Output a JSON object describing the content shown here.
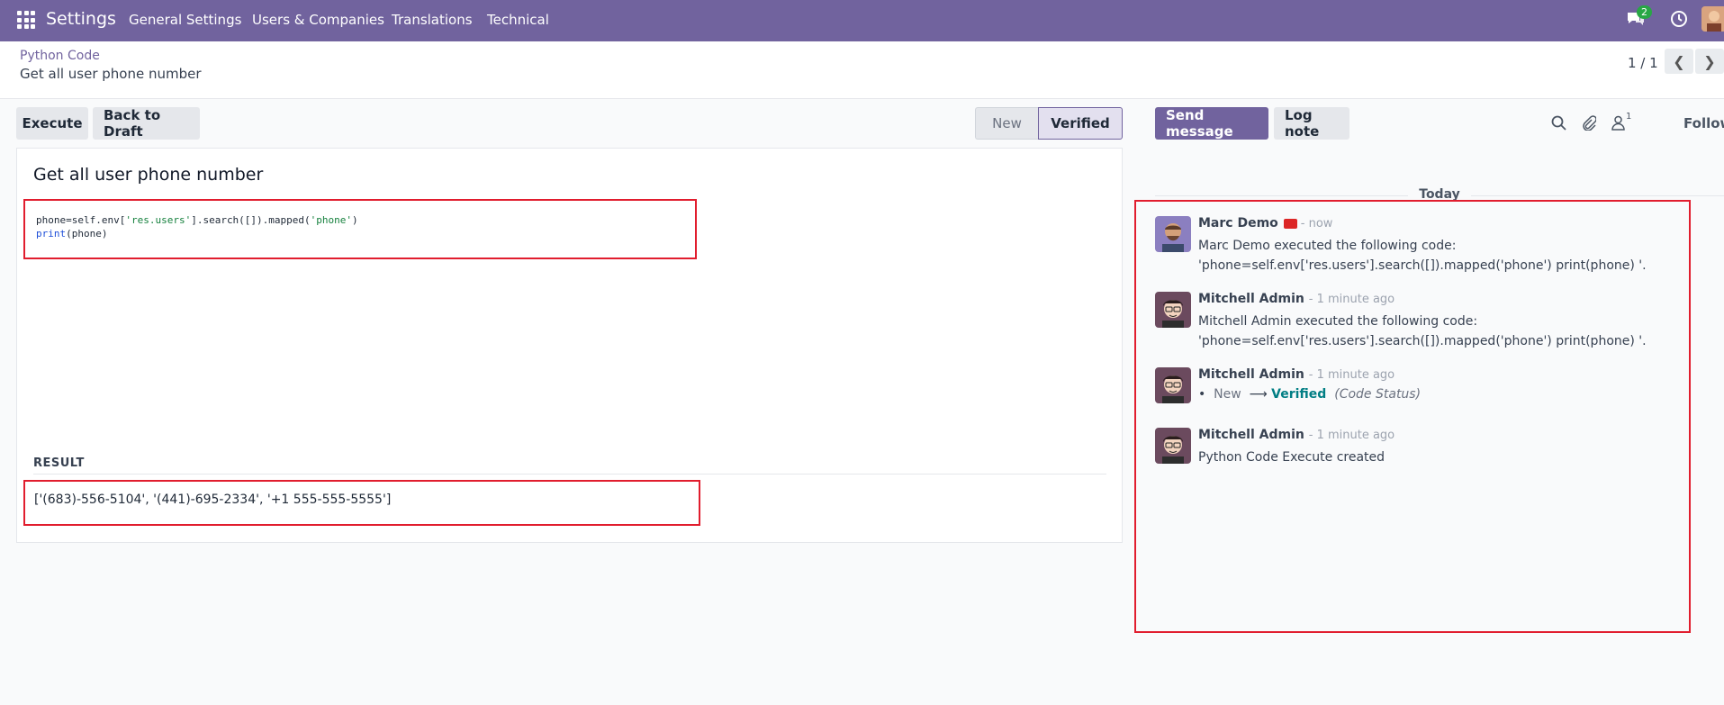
{
  "navbar": {
    "brand": "Settings",
    "menu": [
      "General Settings",
      "Users & Companies",
      "Translations",
      "Technical"
    ],
    "messages_count": "2",
    "apps_icon": "apps-grid-icon",
    "chat_icon": "chat-bubbles-icon",
    "activity_icon": "clock-icon"
  },
  "breadcrumb": {
    "parent": "Python Code",
    "current": "Get all user phone number"
  },
  "pager": {
    "value": "1 / 1"
  },
  "form_buttons": {
    "execute": "Execute",
    "back_to_draft": "Back to Draft"
  },
  "statusbar": {
    "new": "New",
    "verified": "Verified"
  },
  "sheet": {
    "title": "Get all user phone number",
    "code_line1_a": "phone=self.env[",
    "code_line1_str1": "'res.users'",
    "code_line1_b": "].search([]).mapped(",
    "code_line1_str2": "'phone'",
    "code_line1_c": ")",
    "code_line2_kw": "print",
    "code_line2_b": "(phone)",
    "result_label": "RESULT",
    "result_value": "['(683)-556-5104', '(441)-695-2334', '+1 555-555-5555']"
  },
  "chatter": {
    "send_message": "Send message",
    "log_note": "Log note",
    "followers_count": "1",
    "follow": "Follow",
    "today": "Today",
    "messages": [
      {
        "author": "Marc Demo",
        "date": "- now",
        "body_line1": "Marc Demo executed the following code:",
        "body_line2": "'phone=self.env['res.users'].search([]).mapped('phone') print(phone) '."
      },
      {
        "author": "Mitchell Admin",
        "date": "- 1 minute ago",
        "body_line1": "Mitchell Admin executed the following code:",
        "body_line2": "'phone=self.env['res.users'].search([]).mapped('phone') print(phone) '."
      },
      {
        "author": "Mitchell Admin",
        "date": "- 1 minute ago",
        "tracking_old": "New",
        "tracking_new": "Verified",
        "tracking_field": "(Code Status)"
      },
      {
        "author": "Mitchell Admin",
        "date": "- 1 minute ago",
        "body_line1": "Python Code Execute created"
      }
    ]
  }
}
